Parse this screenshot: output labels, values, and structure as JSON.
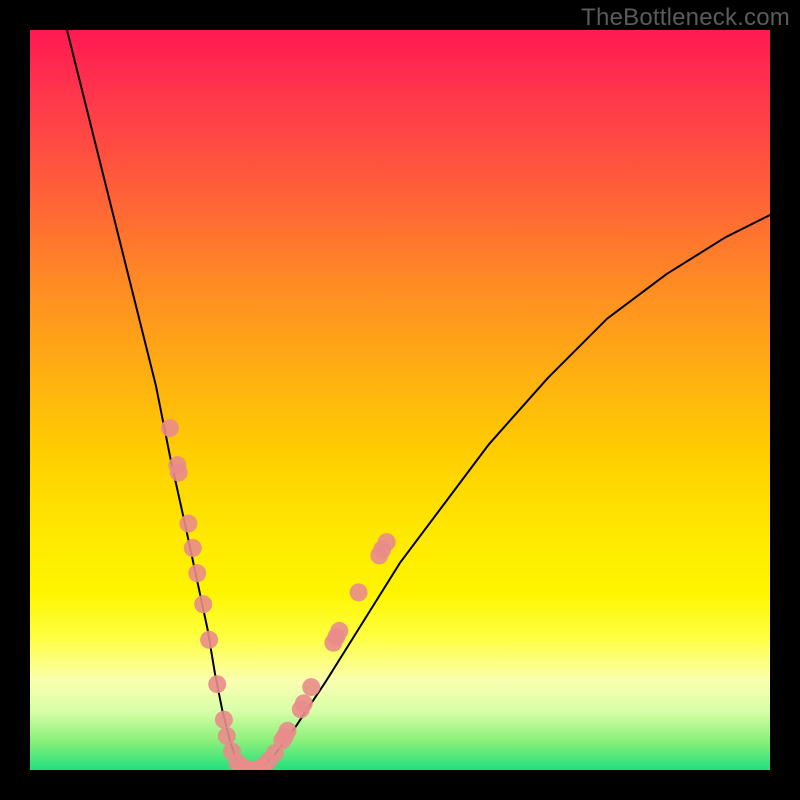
{
  "watermark": "TheBottleneck.com",
  "chart_data": {
    "type": "line",
    "title": "",
    "xlabel": "",
    "ylabel": "",
    "xlim": [
      0,
      100
    ],
    "ylim": [
      0,
      100
    ],
    "grid": false,
    "curve": {
      "x": [
        5,
        8,
        11,
        14,
        17,
        19,
        21,
        22.5,
        24,
        25,
        26,
        27,
        28,
        29.5,
        31,
        33,
        36,
        40,
        45,
        50,
        56,
        62,
        70,
        78,
        86,
        94,
        100
      ],
      "y": [
        100,
        88,
        76,
        64,
        52,
        42,
        33,
        26,
        19,
        13,
        8,
        4,
        1,
        0,
        0,
        2,
        6,
        12,
        20,
        28,
        36,
        44,
        53,
        61,
        67,
        72,
        75
      ]
    },
    "markers": {
      "color": "#e98c8b",
      "radius_approx": 9,
      "points_xy": [
        [
          18.9,
          46.2
        ],
        [
          19.9,
          41.2
        ],
        [
          20.1,
          40.2
        ],
        [
          21.4,
          33.3
        ],
        [
          22.0,
          30.0
        ],
        [
          22.6,
          26.6
        ],
        [
          23.4,
          22.4
        ],
        [
          24.2,
          17.6
        ],
        [
          25.3,
          11.6
        ],
        [
          26.2,
          6.8
        ],
        [
          26.6,
          4.6
        ],
        [
          27.3,
          2.5
        ],
        [
          28.0,
          1.0
        ],
        [
          28.6,
          0.4
        ],
        [
          29.3,
          0.1
        ],
        [
          30.0,
          0.0
        ],
        [
          30.7,
          0.1
        ],
        [
          31.4,
          0.4
        ],
        [
          32.2,
          1.2
        ],
        [
          33.1,
          2.3
        ],
        [
          34.1,
          4.0
        ],
        [
          34.4,
          4.5
        ],
        [
          34.8,
          5.3
        ],
        [
          36.6,
          8.2
        ],
        [
          37.0,
          9.0
        ],
        [
          38.0,
          11.2
        ],
        [
          41.0,
          17.2
        ],
        [
          41.4,
          18.0
        ],
        [
          41.8,
          18.8
        ],
        [
          44.4,
          24.0
        ],
        [
          47.2,
          29.0
        ],
        [
          47.6,
          29.8
        ],
        [
          48.2,
          30.8
        ]
      ]
    }
  }
}
